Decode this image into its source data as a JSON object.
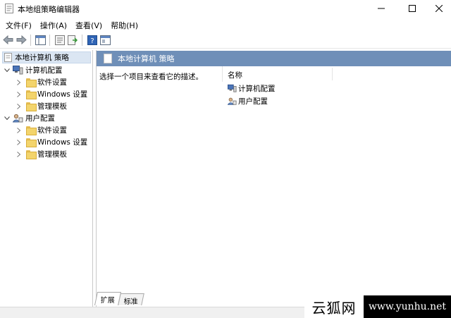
{
  "window": {
    "title": "本地组策略编辑器"
  },
  "menu": [
    "文件(F)",
    "操作(A)",
    "查看(V)",
    "帮助(H)"
  ],
  "toolbar": {
    "icons": [
      "back-arrow-icon",
      "forward-arrow-icon",
      "show-hide-tree-icon",
      "properties-icon",
      "export-list-icon",
      "help-icon",
      "extended-view-icon"
    ]
  },
  "tree": {
    "root": "本地计算机 策略",
    "computer_config": {
      "label": "计算机配置",
      "children": [
        "软件设置",
        "Windows 设置",
        "管理模板"
      ]
    },
    "user_config": {
      "label": "用户配置",
      "children": [
        "软件设置",
        "Windows 设置",
        "管理模板"
      ]
    }
  },
  "detail": {
    "header": "本地计算机 策略",
    "description_prompt": "选择一个项目来查看它的描述。",
    "name_column": "名称",
    "items": [
      "计算机配置",
      "用户配置"
    ]
  },
  "tabs": {
    "extended": "扩展",
    "standard": "标准"
  },
  "watermark": {
    "cn": "云狐网",
    "url": "www.yunhu.net"
  },
  "colors": {
    "header_bar": "#6f8fb8",
    "selection": "#dbe6f3",
    "folder": "#f3d46c"
  }
}
